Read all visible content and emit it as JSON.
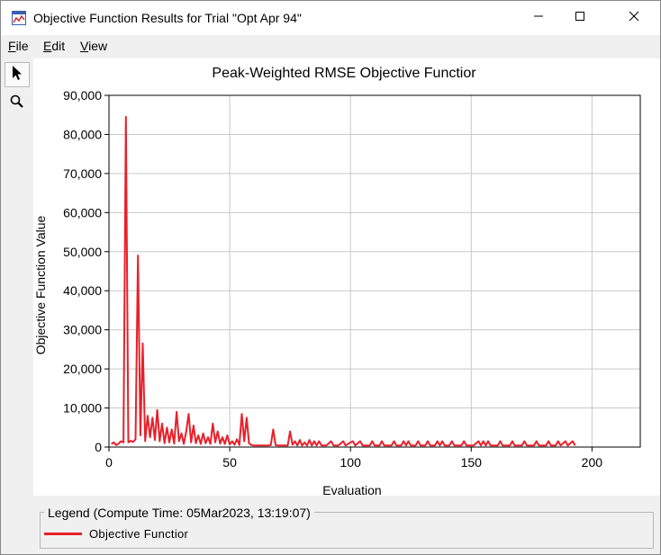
{
  "window": {
    "title": "Objective Function Results for Trial \"Opt Apr 94\"",
    "controls": {
      "minimize": "—",
      "maximize": "☐",
      "close": "✕"
    }
  },
  "menu": {
    "file": {
      "accel": "F",
      "rest": "ile"
    },
    "edit": {
      "accel": "E",
      "rest": "dit"
    },
    "view": {
      "accel": "V",
      "rest": "iew"
    }
  },
  "toolbar": {
    "icons": [
      "arrow-pointer-icon",
      "zoom-magnifier-icon"
    ]
  },
  "colors": {
    "series": "#e8202a",
    "grid": "#c8c8c8",
    "background": "#ffffff"
  },
  "legend": {
    "title": "Legend (Compute Time: 05Mar2023, 13:19:07)",
    "items": [
      {
        "label": "Objective Functior"
      }
    ]
  },
  "chart_data": {
    "type": "line",
    "title": "Peak-Weighted RMSE Objective Functior",
    "xlabel": "Evaluation",
    "ylabel": "Objective Function Value",
    "xlim": [
      0,
      220
    ],
    "ylim": [
      0,
      90000
    ],
    "xticks": [
      0,
      50,
      100,
      150,
      200
    ],
    "xtick_labels": [
      "0",
      "50",
      "100",
      "150",
      "200"
    ],
    "yticks": [
      0,
      10000,
      20000,
      30000,
      40000,
      50000,
      60000,
      70000,
      80000,
      90000
    ],
    "ytick_labels": [
      "0",
      "10,000",
      "20,000",
      "30,000",
      "40,000",
      "50,000",
      "60,000",
      "70,000",
      "80,000",
      "90,000"
    ],
    "grid": true,
    "legend_position": "bottom",
    "series": [
      {
        "name": "Objective Function",
        "points": [
          [
            1,
            800
          ],
          [
            2,
            1200
          ],
          [
            3,
            500
          ],
          [
            4,
            900
          ],
          [
            5,
            1500
          ],
          [
            6,
            1200
          ],
          [
            7,
            84500
          ],
          [
            8,
            1200
          ],
          [
            9,
            1600
          ],
          [
            10,
            1300
          ],
          [
            11,
            2000
          ],
          [
            12,
            49000
          ],
          [
            13,
            3000
          ],
          [
            14,
            26500
          ],
          [
            15,
            1500
          ],
          [
            16,
            8000
          ],
          [
            17,
            2500
          ],
          [
            18,
            7500
          ],
          [
            19,
            1800
          ],
          [
            20,
            9500
          ],
          [
            21,
            1500
          ],
          [
            22,
            6000
          ],
          [
            23,
            1000
          ],
          [
            24,
            5000
          ],
          [
            25,
            1200
          ],
          [
            26,
            4500
          ],
          [
            27,
            900
          ],
          [
            28,
            9000
          ],
          [
            29,
            1500
          ],
          [
            30,
            3500
          ],
          [
            31,
            800
          ],
          [
            32,
            4000
          ],
          [
            33,
            8500
          ],
          [
            34,
            1200
          ],
          [
            35,
            5500
          ],
          [
            36,
            1000
          ],
          [
            37,
            3000
          ],
          [
            38,
            800
          ],
          [
            39,
            3500
          ],
          [
            40,
            1000
          ],
          [
            41,
            2500
          ],
          [
            42,
            800
          ],
          [
            43,
            6000
          ],
          [
            44,
            1200
          ],
          [
            45,
            4000
          ],
          [
            46,
            900
          ],
          [
            47,
            2500
          ],
          [
            48,
            800
          ],
          [
            49,
            3000
          ],
          [
            50,
            700
          ],
          [
            51,
            1500
          ],
          [
            52,
            600
          ],
          [
            53,
            2000
          ],
          [
            54,
            500
          ],
          [
            55,
            8500
          ],
          [
            56,
            1500
          ],
          [
            57,
            7500
          ],
          [
            58,
            1000
          ],
          [
            59,
            500
          ],
          [
            60,
            400
          ],
          [
            62,
            400
          ],
          [
            64,
            400
          ],
          [
            66,
            400
          ],
          [
            67,
            500
          ],
          [
            68,
            4500
          ],
          [
            69,
            500
          ],
          [
            70,
            400
          ],
          [
            72,
            400
          ],
          [
            74,
            400
          ],
          [
            75,
            4000
          ],
          [
            76,
            600
          ],
          [
            77,
            1500
          ],
          [
            78,
            400
          ],
          [
            79,
            1800
          ],
          [
            80,
            400
          ],
          [
            81,
            1200
          ],
          [
            82,
            400
          ],
          [
            83,
            1800
          ],
          [
            84,
            400
          ],
          [
            85,
            1500
          ],
          [
            86,
            400
          ],
          [
            87,
            1500
          ],
          [
            88,
            400
          ],
          [
            90,
            400
          ],
          [
            92,
            1500
          ],
          [
            93,
            400
          ],
          [
            95,
            400
          ],
          [
            97,
            1500
          ],
          [
            98,
            400
          ],
          [
            100,
            1200
          ],
          [
            101,
            1500
          ],
          [
            102,
            400
          ],
          [
            104,
            1500
          ],
          [
            105,
            400
          ],
          [
            108,
            400
          ],
          [
            109,
            1500
          ],
          [
            110,
            400
          ],
          [
            112,
            400
          ],
          [
            113,
            1500
          ],
          [
            114,
            400
          ],
          [
            117,
            400
          ],
          [
            118,
            1500
          ],
          [
            119,
            400
          ],
          [
            121,
            400
          ],
          [
            122,
            1500
          ],
          [
            123,
            400
          ],
          [
            124,
            1500
          ],
          [
            125,
            400
          ],
          [
            127,
            400
          ],
          [
            128,
            1500
          ],
          [
            129,
            400
          ],
          [
            131,
            400
          ],
          [
            132,
            1500
          ],
          [
            133,
            400
          ],
          [
            135,
            400
          ],
          [
            136,
            1500
          ],
          [
            137,
            400
          ],
          [
            138,
            1500
          ],
          [
            139,
            400
          ],
          [
            141,
            400
          ],
          [
            142,
            1500
          ],
          [
            143,
            400
          ],
          [
            146,
            400
          ],
          [
            147,
            1500
          ],
          [
            148,
            400
          ],
          [
            151,
            400
          ],
          [
            153,
            1500
          ],
          [
            154,
            400
          ],
          [
            155,
            1500
          ],
          [
            156,
            400
          ],
          [
            157,
            1500
          ],
          [
            158,
            400
          ],
          [
            161,
            400
          ],
          [
            162,
            1500
          ],
          [
            163,
            400
          ],
          [
            166,
            400
          ],
          [
            167,
            1500
          ],
          [
            168,
            400
          ],
          [
            171,
            400
          ],
          [
            172,
            1500
          ],
          [
            173,
            400
          ],
          [
            176,
            400
          ],
          [
            177,
            1500
          ],
          [
            178,
            400
          ],
          [
            181,
            400
          ],
          [
            182,
            1500
          ],
          [
            183,
            400
          ],
          [
            185,
            400
          ],
          [
            186,
            1500
          ],
          [
            187,
            400
          ],
          [
            189,
            1500
          ],
          [
            190,
            400
          ],
          [
            192,
            1500
          ],
          [
            193,
            400
          ]
        ]
      }
    ]
  }
}
